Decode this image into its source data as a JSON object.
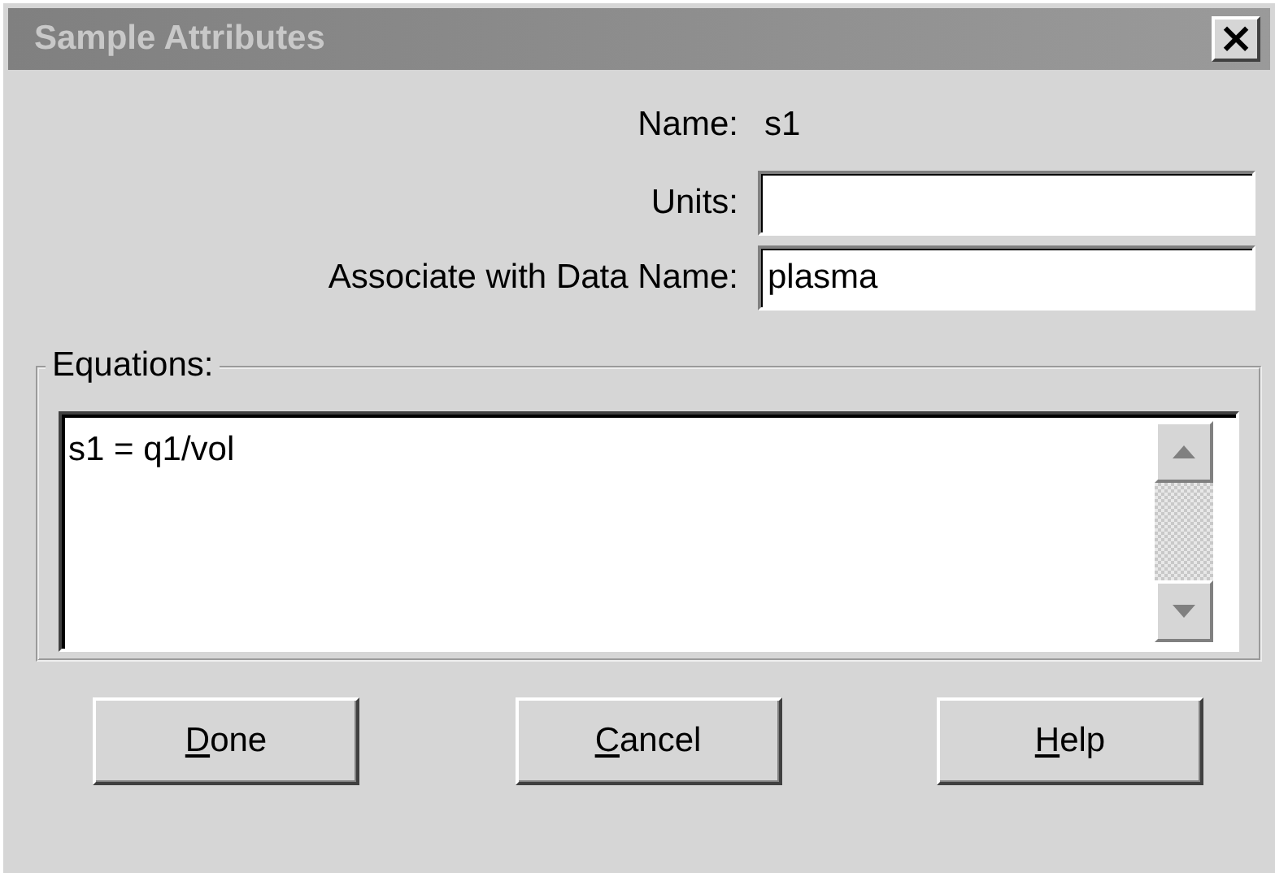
{
  "window": {
    "title": "Sample Attributes",
    "close": "×"
  },
  "fields": [
    {
      "kind": "text",
      "label": "Name:",
      "value": "s1"
    },
    {
      "kind": "input",
      "label": "Units:"
    },
    {
      "kind": "input",
      "label": "Associate with Data Name:",
      "value": "plasma"
    }
  ],
  "equations": {
    "label": "Equations:",
    "value": "s1 = q1/vol"
  },
  "buttons": [
    {
      "label": "Done",
      "underline_first": true
    },
    {
      "label": "Cancel",
      "underline_first": true
    },
    {
      "label": "Help",
      "underline_first": true
    }
  ]
}
